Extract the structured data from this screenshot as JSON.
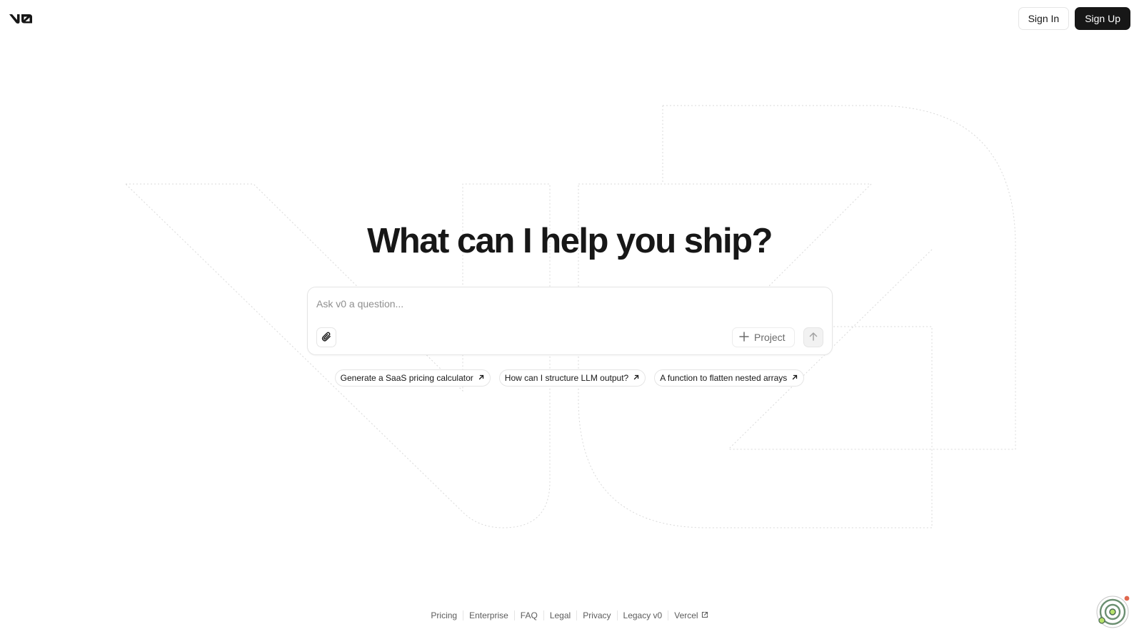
{
  "header": {
    "logo_icon": "v0-logo-icon",
    "sign_in_label": "Sign In",
    "sign_up_label": "Sign Up"
  },
  "hero": {
    "title": "What can I help you ship?"
  },
  "prompt": {
    "placeholder": "Ask v0 a question...",
    "attach_icon": "paperclip-icon",
    "project_label": "Project",
    "project_icon": "plus-icon",
    "send_icon": "arrow-up-icon"
  },
  "suggestions": [
    {
      "label": "Generate a SaaS pricing calculator",
      "icon": "arrow-up-right-icon"
    },
    {
      "label": "How can I structure LLM output?",
      "icon": "arrow-up-right-icon"
    },
    {
      "label": "A function to flatten nested arrays",
      "icon": "arrow-up-right-icon"
    }
  ],
  "footer": {
    "links": [
      "Pricing",
      "Enterprise",
      "FAQ",
      "Legal",
      "Privacy",
      "Legacy v0",
      "Vercel"
    ],
    "external_icon": "external-link-icon"
  },
  "colors": {
    "primary": "#171717",
    "border": "#e5e5e5",
    "muted_text": "#8f8f8f",
    "background": "#ffffff"
  }
}
